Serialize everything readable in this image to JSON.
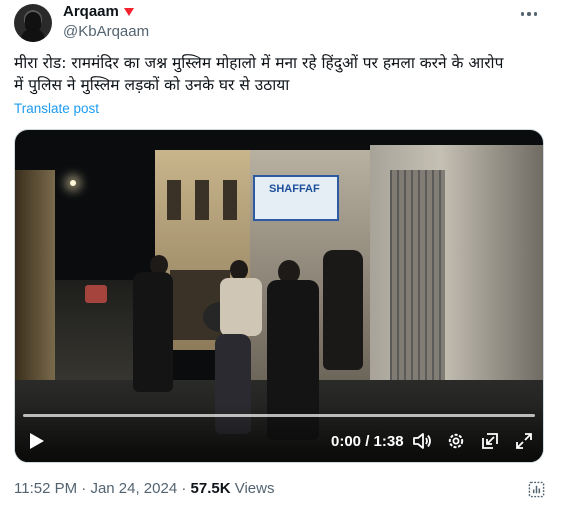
{
  "author": {
    "name": "Arqaam",
    "handle": "@KbArqaam",
    "badge_color": "#f4212e"
  },
  "post": {
    "text_line1": "मीरा रोड: राममंदिर का जश्न मुस्लिम मोहालो में मना रहे हिंदुओं पर हमला करने के आरोप",
    "text_line2": "में पुलिस ने मुस्लिम लड़कों को उनके घर से उठाया",
    "translate_label": "Translate post"
  },
  "video": {
    "sign_text": "SHAFFAF",
    "time_display": "0:00 / 1:38",
    "progress_fraction": 0.0
  },
  "meta": {
    "time": "11:52 PM",
    "separator": "·",
    "date": "Jan 24, 2024",
    "views_count": "57.5K",
    "views_label": "Views"
  },
  "colors": {
    "accent": "#1d9bf0",
    "text": "#0f1419",
    "muted": "#536471"
  }
}
